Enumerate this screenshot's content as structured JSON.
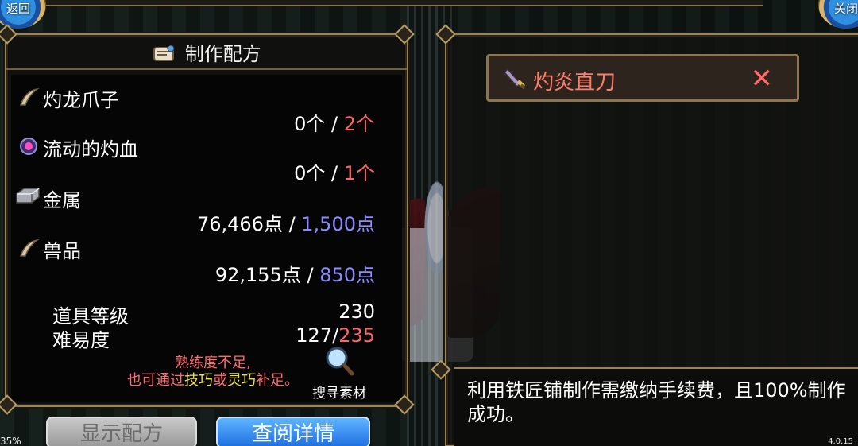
{
  "top": {
    "back_label": "返回",
    "close_label": "关闭"
  },
  "recipe_panel": {
    "title": "制作配方",
    "materials": [
      {
        "name": "灼龙爪子",
        "icon": "claw-icon",
        "have": "0个",
        "need": "2个",
        "need_color": "#ff6666"
      },
      {
        "name": "流动的灼血",
        "icon": "blood-orb-icon",
        "have": "0个",
        "need": "1个",
        "need_color": "#ff6666"
      },
      {
        "name": "金属",
        "icon": "metal-ingot-icon",
        "have": "76,466点",
        "need": "1,500点",
        "need_color": "#8a8cff"
      },
      {
        "name": "兽品",
        "icon": "claw-icon",
        "have": "92,155点",
        "need": "850点",
        "need_color": "#8a8cff"
      }
    ],
    "item_level_label": "道具等级",
    "item_level_value": "230",
    "difficulty_label": "难易度",
    "difficulty_current": "127",
    "difficulty_required": "235",
    "warning_line1": "熟练度不足,",
    "warning_line2_a": "也可通过",
    "warning_line2_b": "技巧",
    "warning_line2_c": "或",
    "warning_line2_d": "灵巧",
    "warning_line2_e": "补足。",
    "search_label": "搜寻素材"
  },
  "buttons": {
    "show_recipe": "显示配方",
    "view_details": "查阅详情"
  },
  "item": {
    "name": "灼炎直刀",
    "close_glyph": "✕"
  },
  "description": "利用铁匠铺制作需缴纳手续费，且100%制作成功。",
  "status": {
    "left": "35%",
    "right": "4.0.15"
  },
  "colors": {
    "border_gold": "#9a8458",
    "shortfall_red": "#ff6666",
    "resource_blue": "#8a8cff",
    "hint_yellow": "#f2e14a"
  }
}
